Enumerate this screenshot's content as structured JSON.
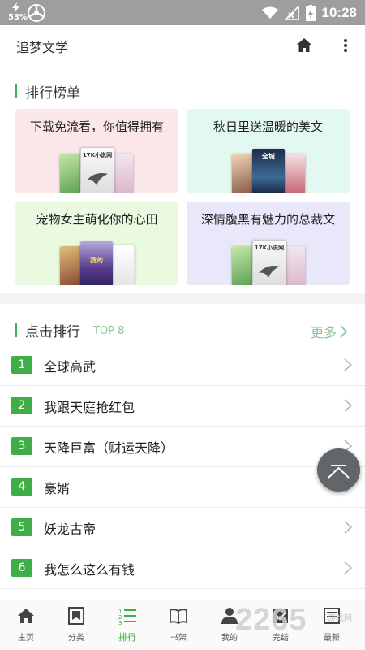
{
  "status_bar": {
    "battery_percent": "53%",
    "time": "10:28"
  },
  "app": {
    "title": "追梦文学"
  },
  "ranking_board": {
    "title": "排行榜单",
    "cards": [
      {
        "title": "下载免流看，你值得拥有",
        "bg": "#fbe7ea"
      },
      {
        "title": "秋日里送温暖的美文",
        "bg": "#e3f8f1"
      },
      {
        "title": "宠物女主萌化你的心田",
        "bg": "#e9fae0"
      },
      {
        "title": "深情腹黑有魅力的总裁文",
        "bg": "#e9e8fb"
      }
    ],
    "cover_texts": {
      "card1": "17K小说网",
      "card2": "全城",
      "card3": "我的",
      "card4": "17K小说网"
    }
  },
  "click_ranking": {
    "title": "点击排行",
    "subtitle": "TOP 8",
    "more_label": "更多",
    "items": [
      {
        "rank": "1",
        "name": "全球高武"
      },
      {
        "rank": "2",
        "name": "我跟天庭抢红包"
      },
      {
        "rank": "3",
        "name": "天降巨富（财运天降）"
      },
      {
        "rank": "4",
        "name": "豪婿"
      },
      {
        "rank": "5",
        "name": "妖龙古帝"
      },
      {
        "rank": "6",
        "name": "我怎么这么有钱"
      }
    ]
  },
  "bottom_nav": {
    "items": [
      {
        "label": "主页",
        "icon": "home-icon"
      },
      {
        "label": "分类",
        "icon": "category-icon"
      },
      {
        "label": "排行",
        "icon": "ranking-icon",
        "active": true
      },
      {
        "label": "书架",
        "icon": "bookshelf-icon"
      },
      {
        "label": "我的",
        "icon": "profile-icon"
      },
      {
        "label": "完结",
        "icon": "completed-icon"
      },
      {
        "label": "最新",
        "icon": "latest-icon"
      }
    ]
  },
  "watermark": {
    "text": "2265",
    "small": "游戏网"
  },
  "colors": {
    "accent": "#3fae46",
    "accent_light": "#8bc492",
    "status_bar": "#9e9e9e"
  }
}
